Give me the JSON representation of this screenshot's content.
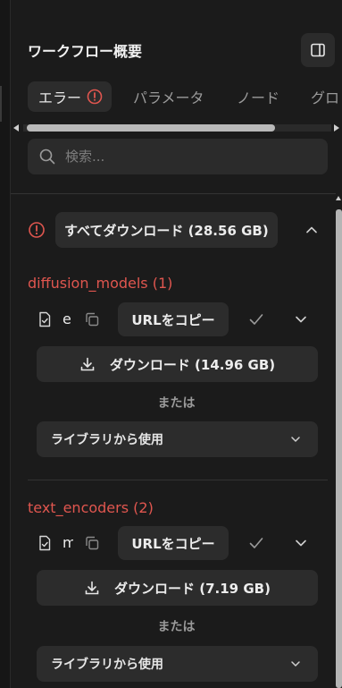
{
  "header": {
    "title": "ワークフロー概要",
    "toggle_icon": "panel-icon"
  },
  "tabs": [
    {
      "label": "エラー",
      "active": true
    },
    {
      "label": "パラメータ",
      "active": false
    },
    {
      "label": "ノード",
      "active": false
    },
    {
      "label": "グロ",
      "active": false
    }
  ],
  "search": {
    "placeholder": "検索..."
  },
  "download_all": {
    "label": "すべてダウンロード (28.56 GB)"
  },
  "groups": [
    {
      "title": "diffusion_models (1)",
      "file_name": "e",
      "url_button": "URLをコピー",
      "download_label": "ダウンロード (14.96 GB)",
      "or_label": "または",
      "library_label": "ライブラリから使用"
    },
    {
      "title": "text_encoders (2)",
      "file_name": "m",
      "url_button": "URLをコピー",
      "download_label": "ダウンロード (7.19 GB)",
      "or_label": "または",
      "library_label": "ライブラリから使用"
    }
  ],
  "colors": {
    "error": "#e0564f",
    "surface": "#2c2c2c",
    "background": "#1b1b1b"
  }
}
